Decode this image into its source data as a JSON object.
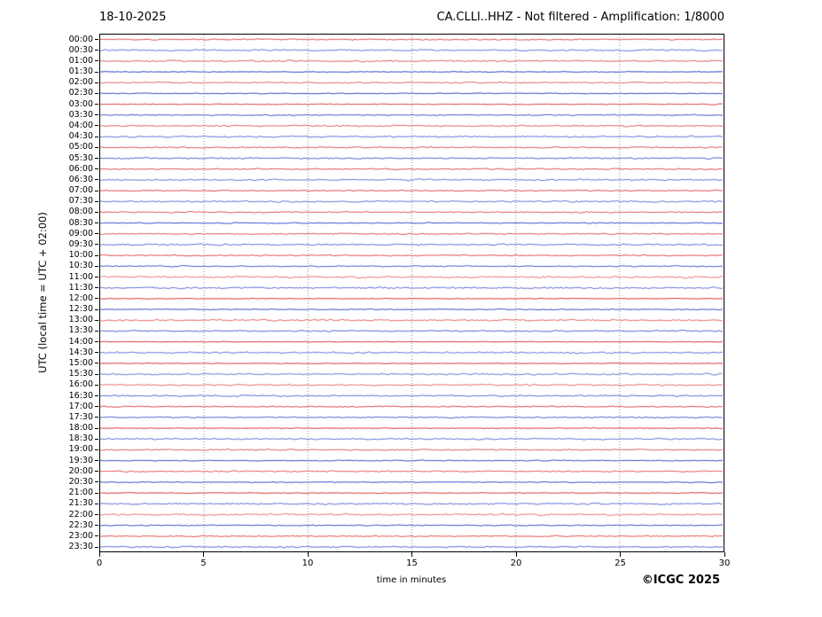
{
  "header": {
    "date": "18-10-2025",
    "title": "CA.CLLI..HHZ - Not filtered - Amplification: 1/8000"
  },
  "footer": {
    "copyright": "©ICGC 2025"
  },
  "chart_data": {
    "type": "line",
    "subtype": "helicorder-seismogram",
    "title": "CA.CLLI..HHZ - Not filtered - Amplification: 1/8000",
    "date": "18-10-2025",
    "xlabel": "time in minutes",
    "ylabel": "UTC (local time = UTC + 02:00)",
    "x_range": [
      0,
      30
    ],
    "x_ticks": [
      0,
      5,
      10,
      15,
      20,
      25,
      30
    ],
    "grid": {
      "vertical_dotted_at_minutes": [
        5,
        10,
        15,
        20,
        25
      ],
      "color": "#999999",
      "style": "dotted"
    },
    "row_labels": [
      "00:00",
      "00:30",
      "01:00",
      "01:30",
      "02:00",
      "02:30",
      "03:00",
      "03:30",
      "04:00",
      "04:30",
      "05:00",
      "05:30",
      "06:00",
      "06:30",
      "07:00",
      "07:30",
      "08:00",
      "08:30",
      "09:00",
      "09:30",
      "10:00",
      "10:30",
      "11:00",
      "11:30",
      "12:00",
      "12:30",
      "13:00",
      "13:30",
      "14:00",
      "14:30",
      "15:00",
      "15:30",
      "16:00",
      "16:30",
      "17:00",
      "17:30",
      "18:00",
      "18:30",
      "19:00",
      "19:30",
      "20:00",
      "20:30",
      "21:00",
      "21:30",
      "22:00",
      "22:30",
      "23:00",
      "23:30"
    ],
    "row_color_rule": {
      "on_hour": "#dd4444",
      "on_half_hour": "#3a4ecc"
    },
    "amplitude_note": "All 48 half-hour traces show flat low-amplitude background noise across the full 30-minute width; no visible seismic events or spikes."
  }
}
